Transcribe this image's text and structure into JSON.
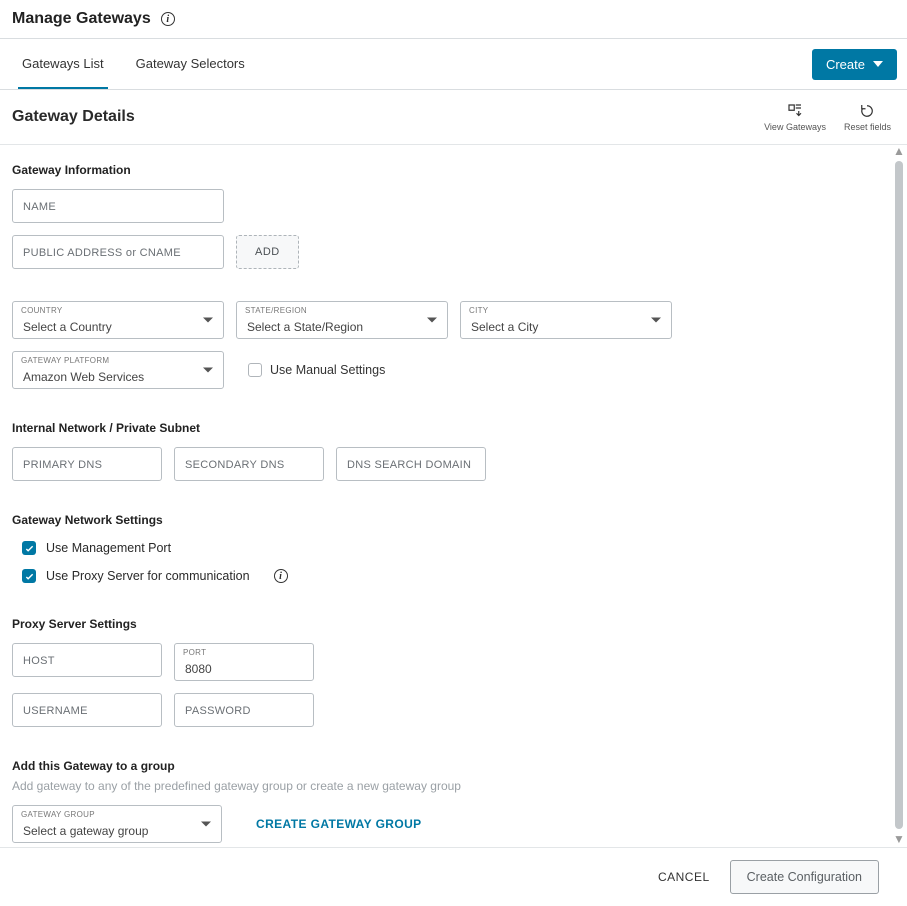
{
  "header": {
    "title": "Manage Gateways"
  },
  "tabs": {
    "items": [
      {
        "label": "Gateways List",
        "active": true
      },
      {
        "label": "Gateway Selectors",
        "active": false
      }
    ],
    "create_label": "Create"
  },
  "details": {
    "title": "Gateway Details",
    "actions": {
      "view_gateways": "View Gateways",
      "reset_fields": "Reset fields"
    }
  },
  "sections": {
    "gw_info": "Gateway Information",
    "internal_net": "Internal Network / Private Subnet",
    "gw_net": "Gateway Network Settings",
    "proxy": "Proxy Server Settings",
    "group": "Add this Gateway to a group",
    "group_sub": "Add gateway to any of the predefined gateway group or create a new gateway group"
  },
  "fields": {
    "name_ph": "NAME",
    "pub_addr_ph": "PUBLIC ADDRESS or CNAME",
    "add_btn": "ADD",
    "country_label": "COUNTRY",
    "country_ph": "Select a Country",
    "state_label": "STATE/REGION",
    "state_ph": "Select a State/Region",
    "city_label": "CITY",
    "city_ph": "Select a City",
    "platform_label": "GATEWAY PLATFORM",
    "platform_val": "Amazon Web Services",
    "manual_settings": "Use Manual Settings",
    "primary_dns_ph": "PRIMARY DNS",
    "secondary_dns_ph": "SECONDARY DNS",
    "dns_search_ph": "DNS SEARCH DOMAIN",
    "use_mgmt_port": "Use Management Port",
    "use_proxy": "Use Proxy Server for communication",
    "host_ph": "HOST",
    "port_label": "PORT",
    "port_val": "8080",
    "username_ph": "USERNAME",
    "password_ph": "PASSWORD",
    "gw_group_label": "GATEWAY GROUP",
    "gw_group_ph": "Select a gateway group",
    "create_gw_group": "CREATE GATEWAY GROUP"
  },
  "footer": {
    "cancel": "CANCEL",
    "create_config": "Create Configuration"
  }
}
